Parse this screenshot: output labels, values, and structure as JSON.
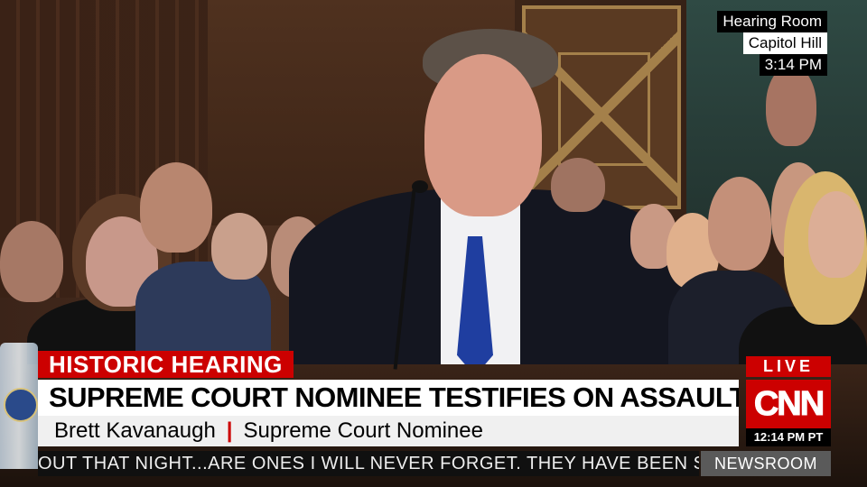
{
  "location_bug": {
    "line1": "Hearing Room",
    "line2": "Capitol Hill",
    "time": "3:14 PM"
  },
  "lower_third": {
    "tag": "HISTORIC HEARING",
    "headline": "SUPREME COURT NOMINEE TESTIFIES ON ASSAULT ACCUSATIONS",
    "name": "Brett Kavanaugh",
    "title": "Supreme Court Nominee",
    "separator": "|"
  },
  "ticker": {
    "text": "OUT THAT NIGHT...ARE ONES I WILL NEVER FORGET. THEY HAVE BEEN SEARE",
    "show_name": "NEWSROOM"
  },
  "network_bug": {
    "live_label": "LIVE",
    "logo_text": "CNN",
    "clock": "12:14 PM PT"
  },
  "colors": {
    "brand_red": "#cc0000",
    "ticker_bg": "#101010",
    "show_bg": "#5a5a5a"
  }
}
